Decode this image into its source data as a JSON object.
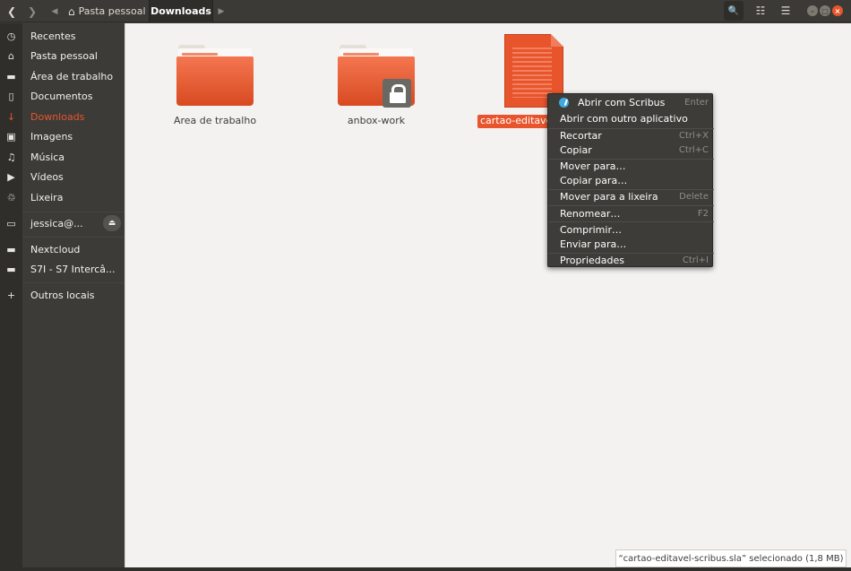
{
  "header": {
    "back_glyph": "❮",
    "forward_glyph": "❯",
    "crumb_left_glyph": "◀",
    "crumb_right_glyph": "▶",
    "home_icon": "⌂",
    "home_label": "Pasta pessoal",
    "current_label": "Downloads",
    "search_icon": "🔍",
    "view_icon": "☷",
    "menu_icon": "☰",
    "min_glyph": "–",
    "max_glyph": "□",
    "close_glyph": "×"
  },
  "sidebar": {
    "items": [
      {
        "icon": "◷",
        "label": "Recentes"
      },
      {
        "icon": "⌂",
        "label": "Pasta pessoal"
      },
      {
        "icon": "▬",
        "label": "Área de trabalho"
      },
      {
        "icon": "▯",
        "label": "Documentos"
      },
      {
        "icon": "↓",
        "label": "Downloads"
      },
      {
        "icon": "▣",
        "label": "Imagens"
      },
      {
        "icon": "♫",
        "label": "Música"
      },
      {
        "icon": "▶",
        "label": "Vídeos"
      },
      {
        "icon": "♲",
        "label": "Lixeira"
      },
      {
        "icon": "▭",
        "label": "jessica@..."
      },
      {
        "icon": "▬",
        "label": "Nextcloud"
      },
      {
        "icon": "▬",
        "label": "S7I - S7 Intercâ..."
      },
      {
        "icon": "+",
        "label": "Outros locais"
      }
    ],
    "eject_icon": "⏏",
    "active_label": "Downloads"
  },
  "files": [
    {
      "name": "Area de trabalho",
      "type": "folder"
    },
    {
      "name": "anbox-work",
      "type": "folder-locked"
    },
    {
      "name": "cartao-editavel-scribus.sla",
      "type": "document",
      "selected": true
    }
  ],
  "context_menu": {
    "items": [
      {
        "label": "Abrir com Scribus",
        "shortcut": "Enter",
        "icon": "scribus-icon"
      },
      {
        "label": "Abrir com outro aplicativo",
        "shortcut": ""
      },
      {
        "label": "Recortar",
        "shortcut": "Ctrl+X"
      },
      {
        "label": "Copiar",
        "shortcut": "Ctrl+C"
      },
      {
        "label": "Mover para…",
        "shortcut": ""
      },
      {
        "label": "Copiar para…",
        "shortcut": ""
      },
      {
        "label": "Mover para a lixeira",
        "shortcut": "Delete"
      },
      {
        "label": "Renomear…",
        "shortcut": "F2"
      },
      {
        "label": "Comprimir…",
        "shortcut": ""
      },
      {
        "label": "Enviar para…",
        "shortcut": ""
      },
      {
        "label": "Propriedades",
        "shortcut": "Ctrl+I"
      }
    ]
  },
  "status": {
    "text": "“cartao-editavel-scribus.sla” selecionado  (1,8 MB)"
  },
  "colors": {
    "accent": "#e8552d",
    "sidebar_bg": "#3c3b37",
    "content_bg": "#f3f2f0",
    "menu_bg": "#3d3c38"
  }
}
